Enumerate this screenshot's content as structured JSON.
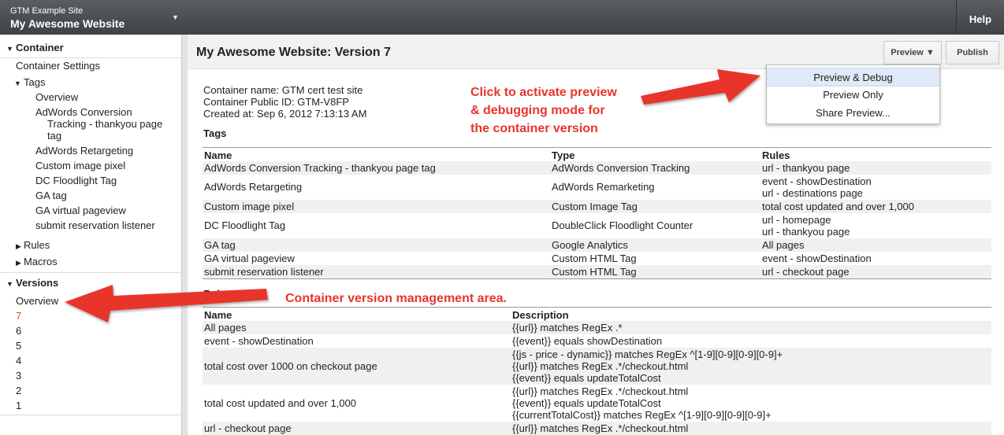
{
  "account": {
    "site": "GTM Example Site",
    "name": "My Awesome Website"
  },
  "topbar": {
    "help": "Help"
  },
  "sidebar": {
    "container_heading": "Container",
    "container_settings": "Container Settings",
    "tags_heading": "Tags",
    "tags": [
      "Overview",
      "AdWords Conversion",
      "Tracking - thankyou page",
      "tag",
      "AdWords Retargeting",
      "Custom image pixel",
      "DC Floodlight Tag",
      "GA tag",
      "GA virtual pageview",
      "submit reservation listener"
    ],
    "rules": "Rules",
    "macros": "Macros",
    "versions_heading": "Versions",
    "versions": [
      "Overview",
      "7",
      "6",
      "5",
      "4",
      "3",
      "2",
      "1"
    ]
  },
  "header": {
    "title": "My Awesome Website: Version 7",
    "preview": "Preview ▼",
    "publish": "Publish"
  },
  "menu": {
    "items": [
      "Preview & Debug",
      "Preview Only",
      "Share Preview..."
    ]
  },
  "info": {
    "name": "Container name: GTM cert test site",
    "public_id": "Container Public ID: GTM-V8FP",
    "created": "Created at: Sep 6, 2012 7:13:13 AM"
  },
  "tags_section": {
    "heading": "Tags",
    "columns": [
      "Name",
      "Type",
      "Rules"
    ],
    "rows": [
      {
        "name": "AdWords Conversion Tracking - thankyou page tag",
        "type": "AdWords Conversion Tracking",
        "rules": [
          "url - thankyou page"
        ]
      },
      {
        "name": "AdWords Retargeting",
        "type": "AdWords Remarketing",
        "rules": [
          "event - showDestination",
          "url - destinations page"
        ]
      },
      {
        "name": "Custom image pixel",
        "type": "Custom Image Tag",
        "rules": [
          "total cost updated and over 1,000"
        ]
      },
      {
        "name": "DC Floodlight Tag",
        "type": "DoubleClick Floodlight Counter",
        "rules": [
          "url - homepage",
          "url - thankyou page"
        ]
      },
      {
        "name": "GA tag",
        "type": "Google Analytics",
        "rules": [
          "All pages"
        ]
      },
      {
        "name": "GA virtual pageview",
        "type": "Custom HTML Tag",
        "rules": [
          "event - showDestination"
        ]
      },
      {
        "name": "submit reservation listener",
        "type": "Custom HTML Tag",
        "rules": [
          "url - checkout page"
        ]
      }
    ]
  },
  "rules_section": {
    "heading": "Rules",
    "columns": [
      "Name",
      "Description"
    ],
    "rows": [
      {
        "name": "All pages",
        "desc": [
          "{{url}} matches RegEx .*"
        ]
      },
      {
        "name": "event - showDestination",
        "desc": [
          "{{event}} equals showDestination"
        ]
      },
      {
        "name": "total cost over 1000 on checkout page",
        "desc": [
          "{{js - price - dynamic}} matches RegEx ^[1-9][0-9][0-9][0-9]+",
          "{{url}} matches RegEx .*/checkout.html",
          "{{event}} equals updateTotalCost"
        ]
      },
      {
        "name": "total cost updated and over 1,000",
        "desc": [
          "{{url}} matches RegEx .*/checkout.html",
          "{{event}} equals updateTotalCost",
          "{{currentTotalCost}} matches RegEx ^[1-9][0-9][0-9][0-9]+"
        ]
      },
      {
        "name": "url - checkout page",
        "desc": [
          "{{url}} matches RegEx .*/checkout.html"
        ]
      }
    ]
  },
  "annotations": {
    "preview": [
      "Click to activate preview",
      "& debugging mode for",
      "the container version"
    ],
    "versions": "Container version management area."
  },
  "colors": {
    "annotation": "#e8352b",
    "active_version": "#dd4b39",
    "highlight": "#dfe9f7"
  }
}
